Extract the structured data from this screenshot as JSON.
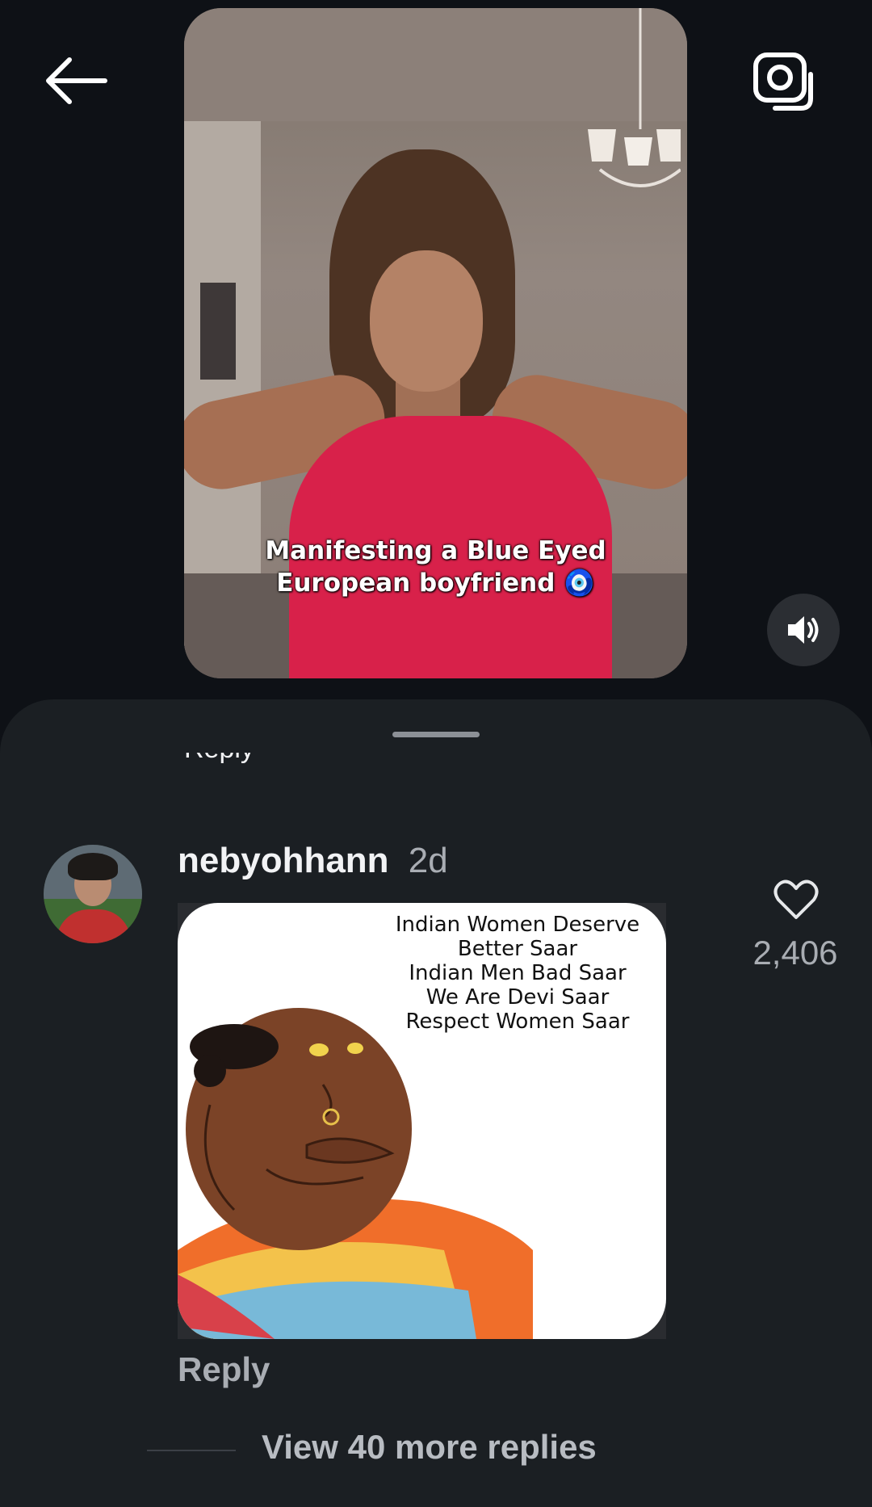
{
  "video": {
    "caption_line1": "Manifesting a Blue Eyed",
    "caption_line2": "European boyfriend 🧿"
  },
  "sheet": {
    "clipped_text": "Reply"
  },
  "comment": {
    "username": "nebyohhann",
    "time": "2d",
    "likes": "2,406",
    "reply_label": "Reply",
    "view_replies_label": "View 40 more replies",
    "meme_lines": [
      "Indian Women Deserve",
      "Better Saar",
      "Indian Men Bad Saar",
      "We Are Devi Saar",
      "Respect Women Saar"
    ]
  },
  "icons": {
    "back": "arrow-left-icon",
    "camera": "camera-icon",
    "mute": "speaker-icon",
    "like": "heart-icon"
  },
  "colors": {
    "background": "#0e1116",
    "sheet": "#1b1f23",
    "muted_text": "#a9adb3",
    "dress": "#d8214a"
  }
}
